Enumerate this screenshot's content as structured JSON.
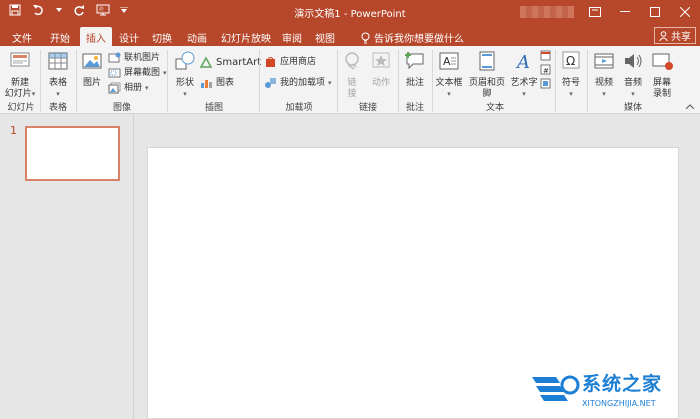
{
  "window": {
    "title": "演示文稿1  -  PowerPoint",
    "qat": [
      "save-icon",
      "undo-icon",
      "redo-icon",
      "present-icon",
      "customize-icon"
    ]
  },
  "tabs": [
    {
      "label": "文件",
      "active": false
    },
    {
      "label": "开始",
      "active": false
    },
    {
      "label": "插入",
      "active": true
    },
    {
      "label": "设计",
      "active": false
    },
    {
      "label": "切换",
      "active": false
    },
    {
      "label": "动画",
      "active": false
    },
    {
      "label": "幻灯片放映",
      "active": false
    },
    {
      "label": "审阅",
      "active": false
    },
    {
      "label": "视图",
      "active": false
    }
  ],
  "tellme": "告诉我你想要做什么",
  "share": "共享",
  "ribbon": {
    "groups": {
      "slides": "幻灯片",
      "tables": "表格",
      "images": "图像",
      "illustrations": "插图",
      "addins": "加载项",
      "links": "链接",
      "comments": "批注",
      "text": "文本",
      "media": "媒体"
    },
    "buttons": {
      "new_slide_1": "新建",
      "new_slide_2": "幻灯片",
      "table": "表格",
      "picture": "图片",
      "online_pictures": "联机图片",
      "screenshot": "屏幕截图",
      "album": "相册",
      "shapes": "形状",
      "smartart": "SmartArt",
      "chart": "图表",
      "store": "应用商店",
      "my_addins": "我的加载项",
      "link_1": "链",
      "link_2": "接",
      "action": "动作",
      "comment": "批注",
      "textbox": "文本框",
      "header_footer": "页眉和页脚",
      "wordart": "艺术字",
      "symbols": "符号",
      "video": "视频",
      "audio": "音频",
      "screen_record_1": "屏幕",
      "screen_record_2": "录制"
    }
  },
  "slides_pane": {
    "slide_number": "1"
  },
  "watermark": {
    "brand": "系统之家",
    "url": "XITONGZHIJIA.NET"
  },
  "colors": {
    "accent": "#b7472a",
    "ribbon_bg": "#f3f3f3",
    "workspace": "#e6e6e6",
    "thumb_border": "#d9826a"
  }
}
